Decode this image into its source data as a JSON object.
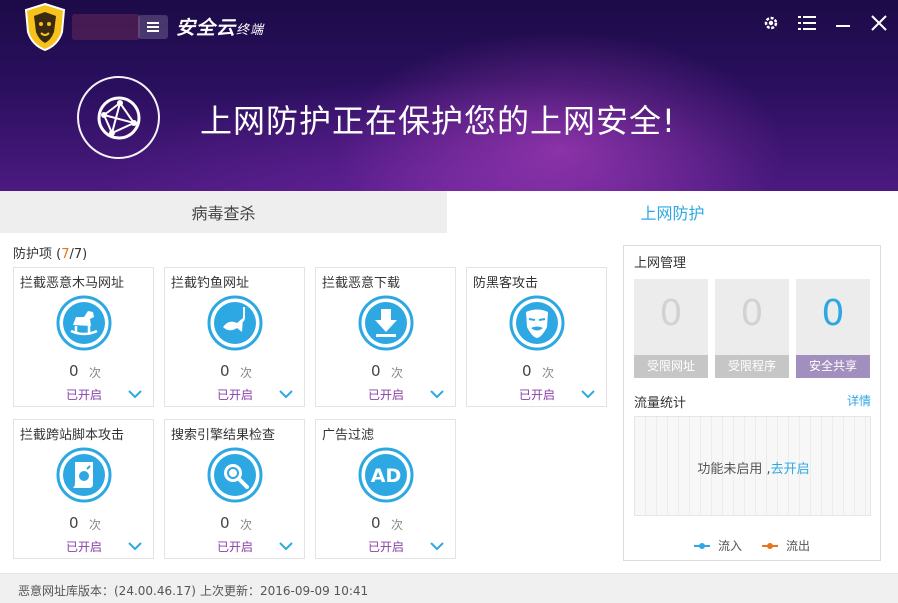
{
  "app": {
    "brand_main": "安全云",
    "brand_sub": "终端"
  },
  "hero": {
    "message": "上网防护正在保护您的上网安全!"
  },
  "tabs": [
    {
      "label": "病毒查杀"
    },
    {
      "label": "上网防护"
    }
  ],
  "protection": {
    "title_prefix": "防护项 (",
    "enabled_count": "7",
    "title_suffix": "/7)",
    "items": [
      {
        "name": "拦截恶意木马网址",
        "icon": "rocking-horse-icon",
        "count": "0",
        "unit": "次",
        "status": "已开启"
      },
      {
        "name": "拦截钓鱼网址",
        "icon": "fish-hook-icon",
        "count": "0",
        "unit": "次",
        "status": "已开启"
      },
      {
        "name": "拦截恶意下载",
        "icon": "download-arrow-icon",
        "count": "0",
        "unit": "次",
        "status": "已开启"
      },
      {
        "name": "防黑客攻击",
        "icon": "hacker-mask-icon",
        "count": "0",
        "unit": "次",
        "status": "已开启"
      },
      {
        "name": "拦截跨站脚本攻击",
        "icon": "script-scroll-icon",
        "count": "0",
        "unit": "次",
        "status": "已开启"
      },
      {
        "name": "搜索引擎结果检查",
        "icon": "search-magnifier-icon",
        "count": "0",
        "unit": "次",
        "status": "已开启"
      },
      {
        "name": "广告过滤",
        "icon": "ad-icon",
        "count": "0",
        "unit": "次",
        "status": "已开启",
        "icon_text": "AD"
      }
    ]
  },
  "web_management": {
    "title": "上网管理",
    "stats": [
      {
        "value": "0",
        "label": "受限网址"
      },
      {
        "value": "0",
        "label": "受限程序"
      },
      {
        "value": "0",
        "label": "安全共享"
      }
    ]
  },
  "traffic": {
    "title": "流量统计",
    "detail_link": "详情",
    "message": "功能未启用 ,",
    "enable_link": "去开启",
    "legend_in": "流入",
    "legend_out": "流出"
  },
  "footer": {
    "db_version": "恶意网址库版本：(24.00.46.17)",
    "last_update": "上次更新：2016-09-09 10:41"
  },
  "colors": {
    "accent": "#2ea8e3",
    "status_purple": "#8a3fa9",
    "highlight_orange": "#e8741f",
    "header_dark": "#1c0b47"
  }
}
